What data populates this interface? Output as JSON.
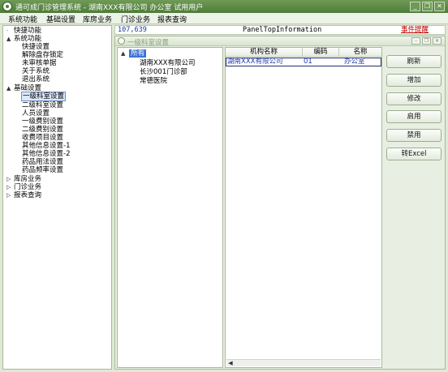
{
  "window": {
    "title": "通可成门诊管理系统 - 湖南XXX有限公司 办公室 试用用户",
    "min_label": "_",
    "restore_label": "❐",
    "close_label": "✕"
  },
  "menu": [
    "系统功能",
    "基础设置",
    "库房业务",
    "门诊业务",
    "报表查询"
  ],
  "nav_tree": [
    {
      "label": "快捷功能",
      "level": 0,
      "expander": ""
    },
    {
      "label": "系统功能",
      "level": 0,
      "expander": "▲"
    },
    {
      "label": "快捷设置",
      "level": 1
    },
    {
      "label": "解除盘存锁定",
      "level": 1
    },
    {
      "label": "未审核单据",
      "level": 1
    },
    {
      "label": "关于系统",
      "level": 1
    },
    {
      "label": "退出系统",
      "level": 1
    },
    {
      "label": "基础设置",
      "level": 0,
      "expander": "▲"
    },
    {
      "label": "一级科室设置",
      "level": 1,
      "selected": true
    },
    {
      "label": "二级科室设置",
      "level": 1
    },
    {
      "label": "人员设置",
      "level": 1
    },
    {
      "label": "一级费别设置",
      "level": 1
    },
    {
      "label": "二级费别设置",
      "level": 1
    },
    {
      "label": "收费项目设置",
      "level": 1
    },
    {
      "label": "其他信息设置-1",
      "level": 1
    },
    {
      "label": "其他信息设置-2",
      "level": 1
    },
    {
      "label": "药品用法设置",
      "level": 1
    },
    {
      "label": "药品频率设置",
      "level": 1
    },
    {
      "label": "库房业务",
      "level": 0,
      "expander": "▷"
    },
    {
      "label": "门诊业务",
      "level": 0,
      "expander": "▷"
    },
    {
      "label": "报表查询",
      "level": 0,
      "expander": "▷"
    }
  ],
  "info": {
    "count": "107,639",
    "panel": "PanelTopInformation",
    "event": "事件提醒"
  },
  "child_window": {
    "title": "一级科室设置",
    "btn1": "–",
    "btn2": "❐",
    "btn3": "✕"
  },
  "org_tree": {
    "root": "所有",
    "items": [
      "湖南XXX有限公司",
      "长沙001门诊部",
      "常德医院"
    ]
  },
  "grid": {
    "columns": [
      "机构名称",
      "编码",
      "名称"
    ],
    "rows": [
      [
        "湖南XXX有限公司",
        "01",
        "办公室"
      ]
    ]
  },
  "actions": [
    "刷新",
    "增加",
    "修改",
    "启用",
    "禁用",
    "转Excel"
  ]
}
